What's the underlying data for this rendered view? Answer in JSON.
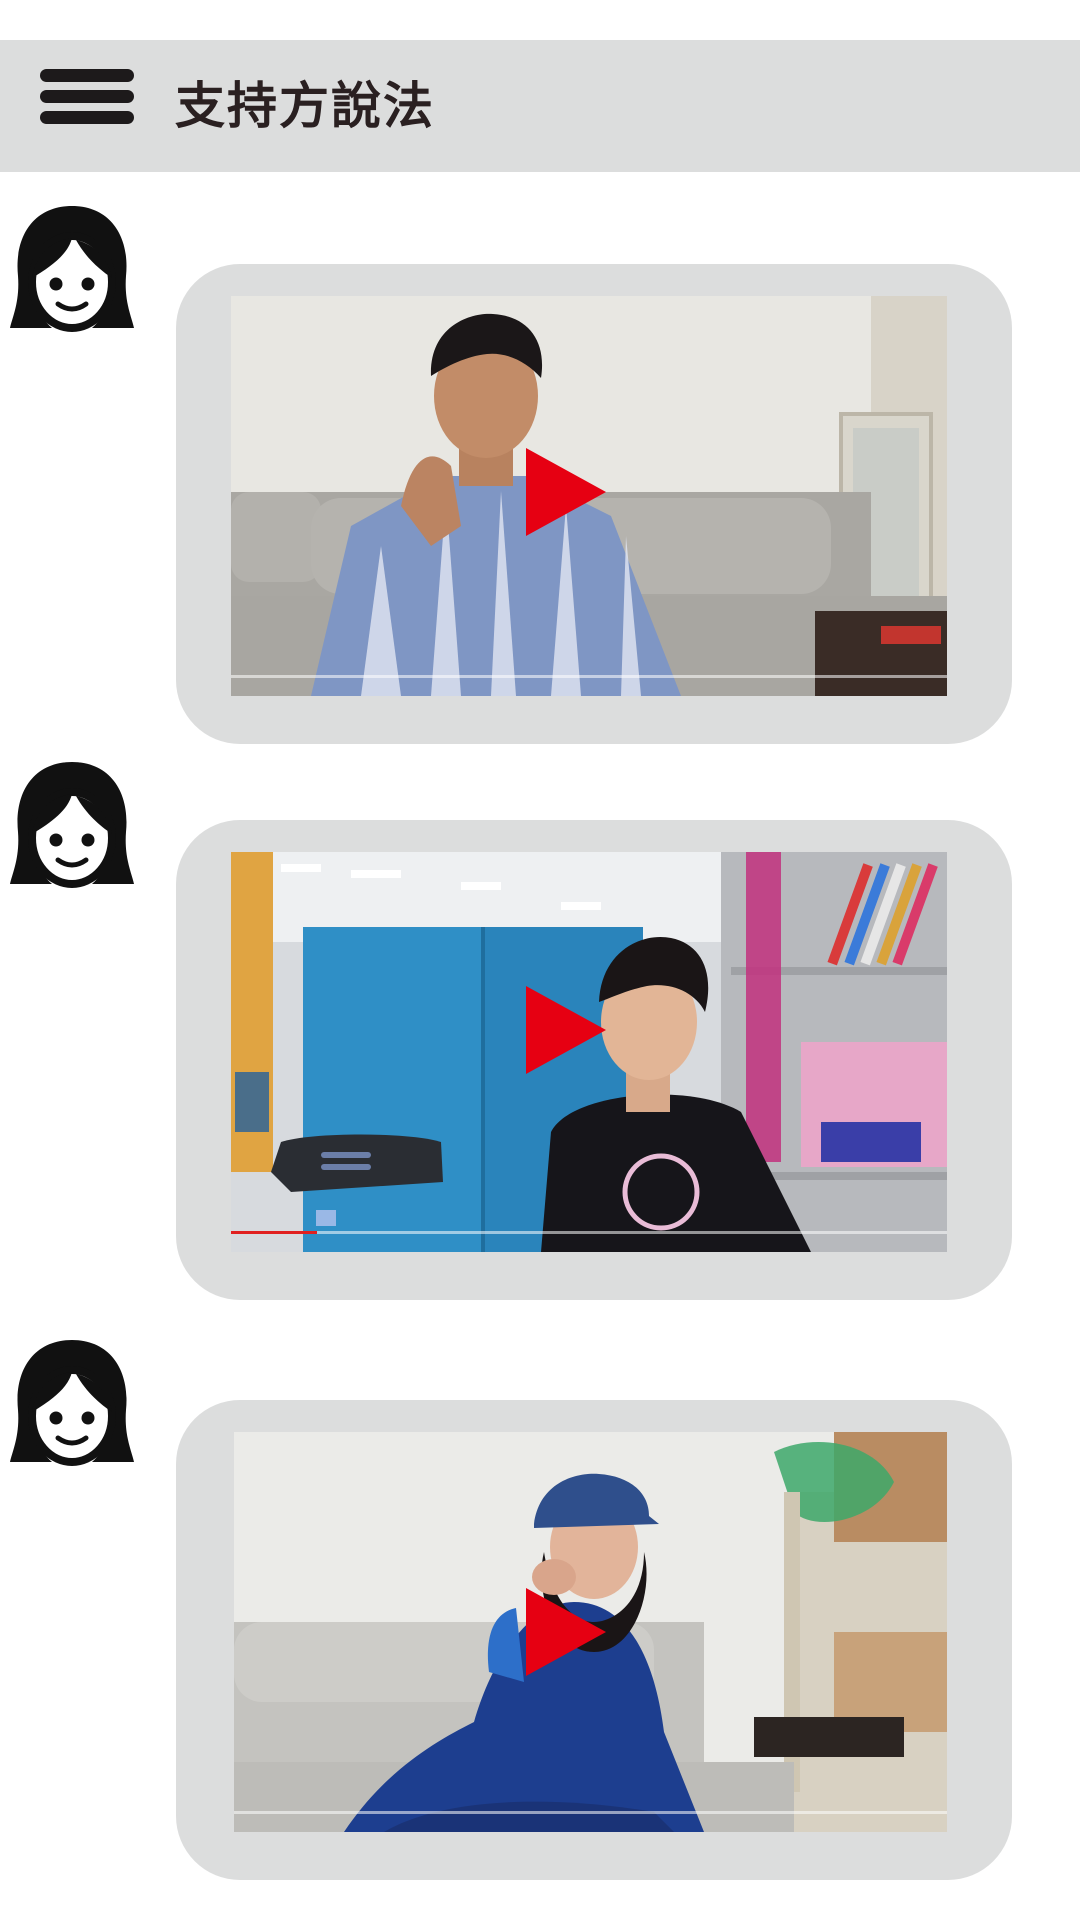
{
  "header": {
    "title": "支持方說法"
  },
  "icons": {
    "menu": "hamburger-menu-icon",
    "avatar": "woman-avatar-icon",
    "play": "play-triangle-icon"
  },
  "colors": {
    "header_bg": "#dcdddd",
    "card_bg": "#dcdddd",
    "play_red": "#e60012",
    "text_dark": "#2a2021"
  },
  "feed": [
    {
      "progress": 0
    },
    {
      "progress": 0.12
    },
    {
      "progress": 0
    }
  ]
}
